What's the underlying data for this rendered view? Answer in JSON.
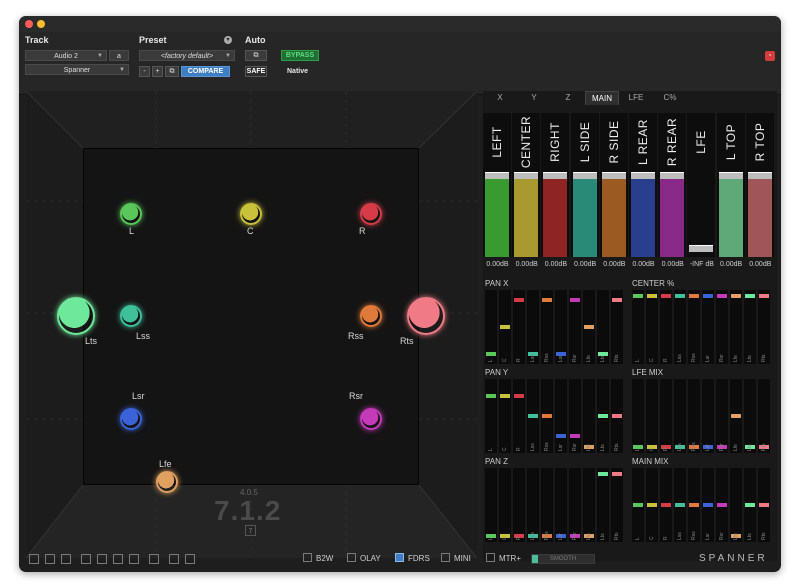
{
  "header": {
    "track_label": "Track",
    "track_name": "Audio 2",
    "track_variant": "a",
    "plugin_name": "Spanner",
    "preset_label": "Preset",
    "preset_value": "<factory default>",
    "compare_label": "COMPARE",
    "auto_label": "Auto",
    "safe_label": "SAFE",
    "bypass_label": "BYPASS",
    "native_label": "Native",
    "minus_label": "-",
    "plus_label": "+"
  },
  "panner": {
    "format_small": "4.0.5",
    "format_big": "7.1.2",
    "format_small_btn": "7",
    "speakers": [
      {
        "label": "L",
        "color": "#59c759",
        "size": "small"
      },
      {
        "label": "C",
        "color": "#c9c13a",
        "size": "small"
      },
      {
        "label": "R",
        "color": "#d63c48",
        "size": "small"
      },
      {
        "label": "Lts",
        "color": "#6ee89a",
        "size": "large"
      },
      {
        "label": "Lss",
        "color": "#3fbf9a",
        "size": "small"
      },
      {
        "label": "Rss",
        "color": "#e07a3a",
        "size": "small"
      },
      {
        "label": "Rts",
        "color": "#f07b86",
        "size": "large"
      },
      {
        "label": "Lsr",
        "color": "#3b63d8",
        "size": "small"
      },
      {
        "label": "Rsr",
        "color": "#c43ab8",
        "size": "small"
      },
      {
        "label": "Lfe",
        "color": "#e0a060",
        "size": "small"
      }
    ]
  },
  "tabs": [
    "X",
    "Y",
    "Z",
    "MAIN",
    "LFE",
    "C%"
  ],
  "active_tab": "MAIN",
  "channels": [
    {
      "name": "LEFT",
      "db": "0.00dB",
      "color": "#3a9a32",
      "level": 1.0
    },
    {
      "name": "CENTER",
      "db": "0.00dB",
      "color": "#a89a2e",
      "level": 1.0
    },
    {
      "name": "RIGHT",
      "db": "0.00dB",
      "color": "#8e2424",
      "level": 1.0
    },
    {
      "name": "L SIDE",
      "db": "0.00dB",
      "color": "#2a8a78",
      "level": 1.0
    },
    {
      "name": "R SIDE",
      "db": "0.00dB",
      "color": "#9a5a22",
      "level": 1.0
    },
    {
      "name": "L REAR",
      "db": "0.00dB",
      "color": "#2a3e8e",
      "level": 1.0
    },
    {
      "name": "R REAR",
      "db": "0.00dB",
      "color": "#8a2a88",
      "level": 1.0
    },
    {
      "name": "LFE",
      "db": "-INF dB",
      "color": "#111111",
      "level": 0.0
    },
    {
      "name": "L TOP",
      "db": "0.00dB",
      "color": "#5fa878",
      "level": 1.0
    },
    {
      "name": "R TOP",
      "db": "0.00dB",
      "color": "#a05658",
      "level": 1.0
    }
  ],
  "strip_labels": [
    "L",
    "C",
    "R",
    "Lss",
    "Rss",
    "Lsr",
    "Rsr",
    "Lfe",
    "Lts",
    "Rts"
  ],
  "strip_colors": [
    "#59c759",
    "#c9c13a",
    "#d63c48",
    "#3fbf9a",
    "#e07a3a",
    "#3b63d8",
    "#c43ab8",
    "#e0a060",
    "#6ee89a",
    "#f07b86"
  ],
  "subpanels": [
    {
      "title": "PAN X",
      "values": [
        0.1,
        0.5,
        0.9,
        0.1,
        0.9,
        0.1,
        0.9,
        0.5,
        0.1,
        0.9
      ]
    },
    {
      "title": "CENTER %",
      "values": [
        0.95,
        0.95,
        0.95,
        0.95,
        0.95,
        0.95,
        0.95,
        0.95,
        0.95,
        0.95
      ]
    },
    {
      "title": "PAN Y",
      "values": [
        0.8,
        0.8,
        0.8,
        0.5,
        0.5,
        0.2,
        0.2,
        0.05,
        0.5,
        0.5
      ]
    },
    {
      "title": "LFE MIX",
      "values": [
        0.05,
        0.05,
        0.05,
        0.05,
        0.05,
        0.05,
        0.05,
        0.5,
        0.05,
        0.05
      ]
    },
    {
      "title": "PAN Z",
      "values": [
        0.05,
        0.05,
        0.05,
        0.05,
        0.05,
        0.05,
        0.05,
        0.05,
        0.95,
        0.95
      ]
    },
    {
      "title": "MAIN MIX",
      "values": [
        0.5,
        0.5,
        0.5,
        0.5,
        0.5,
        0.5,
        0.5,
        0.05,
        0.5,
        0.5
      ]
    }
  ],
  "bottom": {
    "b2w_label": "B2W",
    "olay_label": "OLAY",
    "fdrs_label": "FDRS",
    "mini_label": "MINI",
    "mtr_label": "MTR+",
    "smooth_label": "SMOOTH",
    "brand": "SPANNER"
  },
  "colors": {
    "accent": "#3e7fc4",
    "bypass": "#2f9e4a",
    "close": "#d33c3c"
  }
}
